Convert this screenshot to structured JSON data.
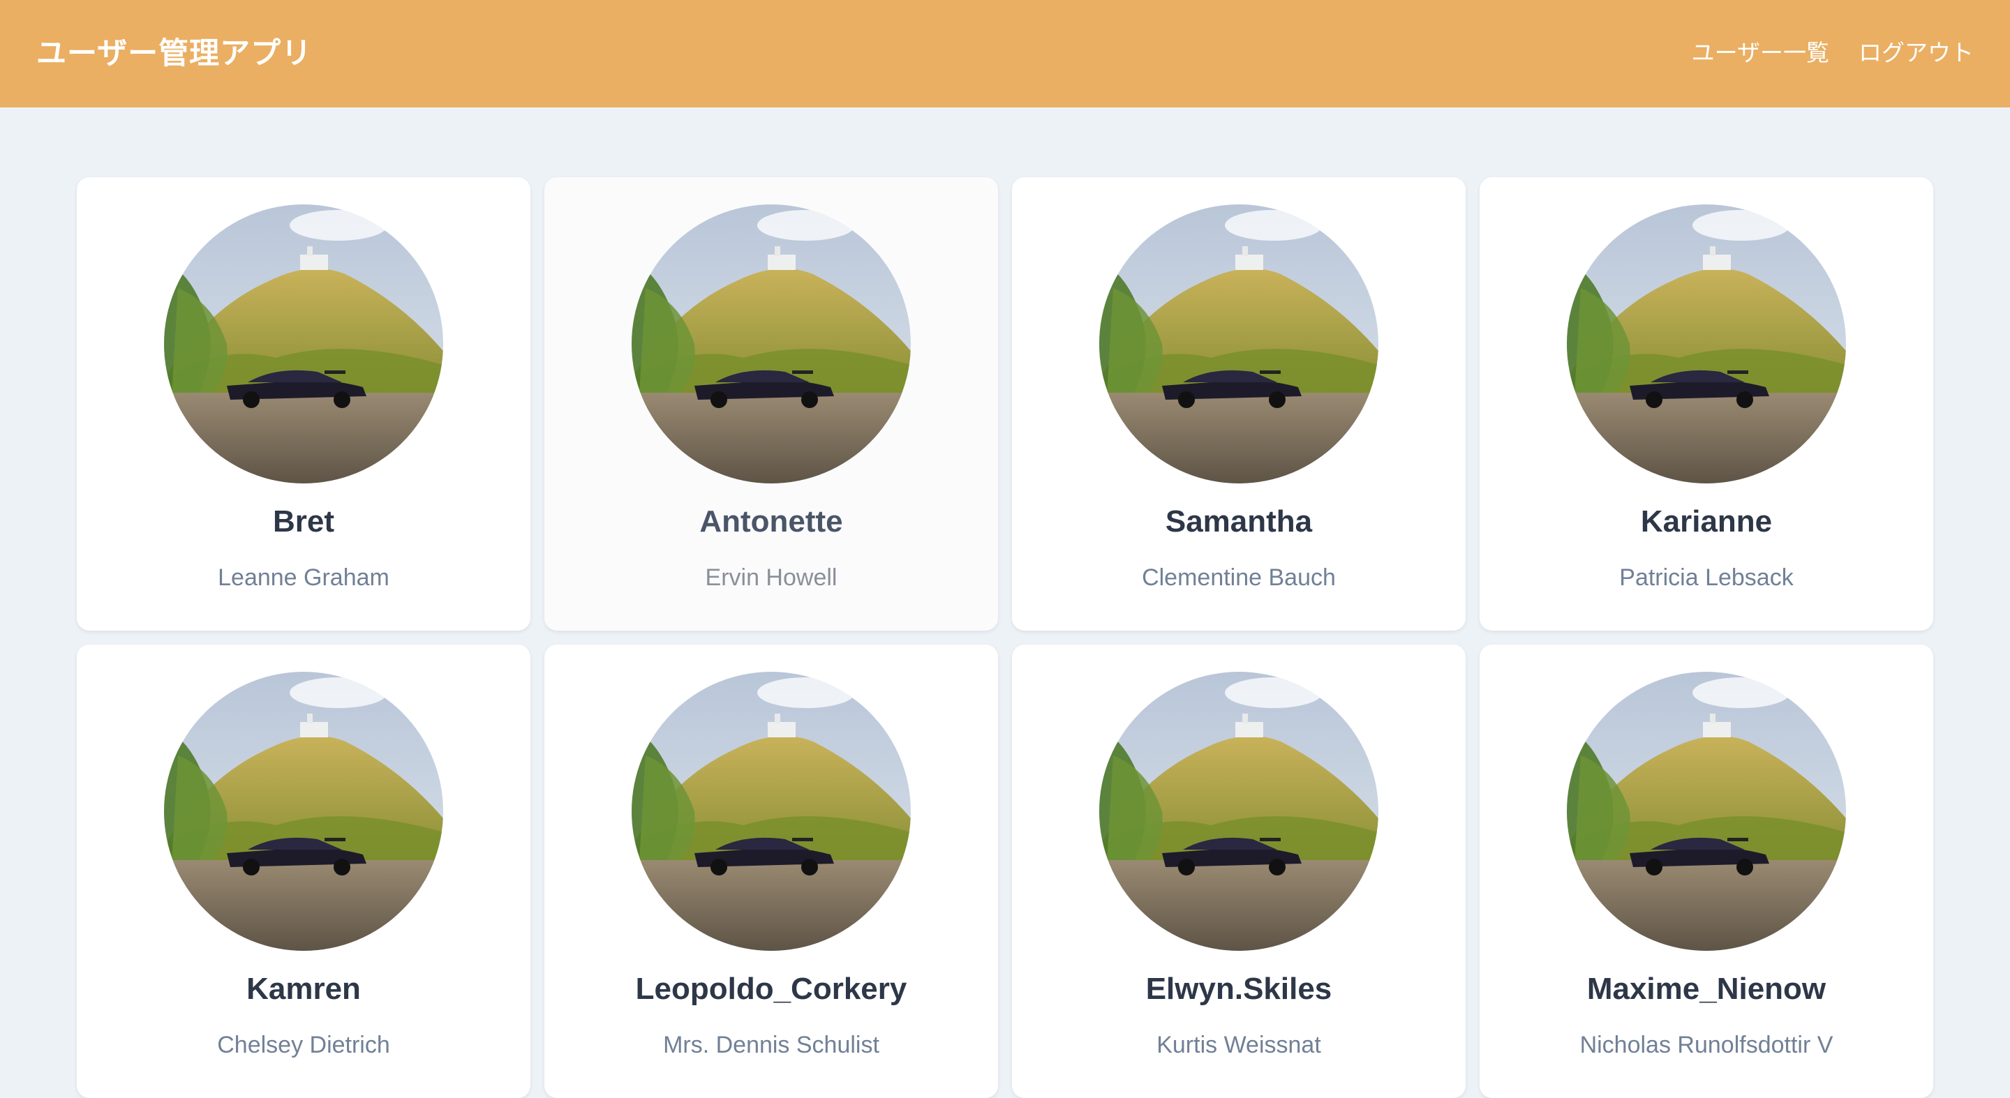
{
  "header": {
    "title": "ユーザー管理アプリ",
    "nav": [
      {
        "label": "ユーザー一覧"
      },
      {
        "label": "ログアウト"
      }
    ]
  },
  "users": [
    {
      "username": "Bret",
      "name": "Leanne Graham"
    },
    {
      "username": "Antonette",
      "name": "Ervin Howell"
    },
    {
      "username": "Samantha",
      "name": "Clementine Bauch"
    },
    {
      "username": "Karianne",
      "name": "Patricia Lebsack"
    },
    {
      "username": "Kamren",
      "name": "Chelsey Dietrich"
    },
    {
      "username": "Leopoldo_Corkery",
      "name": "Mrs. Dennis Schulist"
    },
    {
      "username": "Elwyn.Skiles",
      "name": "Kurtis Weissnat"
    },
    {
      "username": "Maxime_Nienow",
      "name": "Nicholas Runolfsdottir V"
    }
  ],
  "colors": {
    "header_bg": "#eaaf63",
    "page_bg": "#edf2f7",
    "card_bg": "#ffffff",
    "username_text": "#2d3748",
    "name_text": "#718096"
  }
}
